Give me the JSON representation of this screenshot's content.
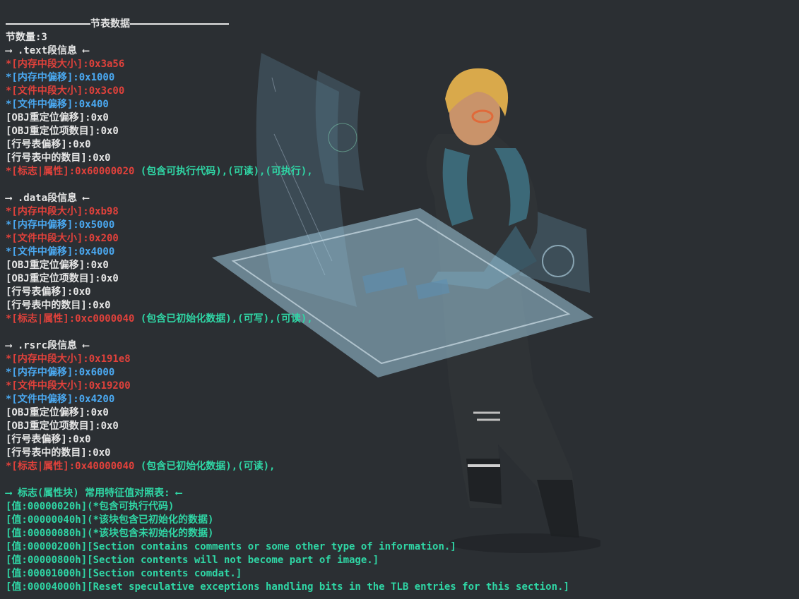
{
  "colors": {
    "background": "#2b2f33",
    "text_default": "#e6e6e6",
    "text_size_field": "#e0413b",
    "text_offset_field": "#4aa8f0",
    "text_flag_desc": "#2fd6a5"
  },
  "header": {
    "title": "节表数据",
    "count": "节数量:3"
  },
  "sections": [
    {
      "heading": "⟶ .text段信息 ⟵",
      "mem_size": "*[内存中段大小]:0x3a56",
      "mem_offset": "*[内存中偏移]:0x1000",
      "file_size": "*[文件中段大小]:0x3c00",
      "file_offset": "*[文件中偏移]:0x400",
      "obj_reloc_offset": "[OBJ重定位偏移]:0x0",
      "obj_reloc_count": "[OBJ重定位项数目]:0x0",
      "line_table_offset": "[行号表偏移]:0x0",
      "line_table_count": "[行号表中的数目]:0x0",
      "flags_value": "*[标志|属性]:0x60000020",
      "flags_desc": "(包含可执行代码),(可读),(可执行),"
    },
    {
      "heading": "⟶ .data段信息 ⟵",
      "mem_size": "*[内存中段大小]:0xb98",
      "mem_offset": "*[内存中偏移]:0x5000",
      "file_size": "*[文件中段大小]:0x200",
      "file_offset": "*[文件中偏移]:0x4000",
      "obj_reloc_offset": "[OBJ重定位偏移]:0x0",
      "obj_reloc_count": "[OBJ重定位项数目]:0x0",
      "line_table_offset": "[行号表偏移]:0x0",
      "line_table_count": "[行号表中的数目]:0x0",
      "flags_value": "*[标志|属性]:0xc0000040",
      "flags_desc": "(包含已初始化数据),(可写),(可读),"
    },
    {
      "heading": "⟶ .rsrc段信息 ⟵",
      "mem_size": "*[内存中段大小]:0x191e8",
      "mem_offset": "*[内存中偏移]:0x6000",
      "file_size": "*[文件中段大小]:0x19200",
      "file_offset": "*[文件中偏移]:0x4200",
      "obj_reloc_offset": "[OBJ重定位偏移]:0x0",
      "obj_reloc_count": "[OBJ重定位项数目]:0x0",
      "line_table_offset": "[行号表偏移]:0x0",
      "line_table_count": "[行号表中的数目]:0x0",
      "flags_value": "*[标志|属性]:0x40000040",
      "flags_desc": "(包含已初始化数据),(可读),"
    }
  ],
  "reference": {
    "heading": "⟶ 标志(属性块) 常用特征值对照表: ⟵",
    "rows": [
      "[值:00000020h](*包含可执行代码)",
      "[值:00000040h](*该块包含已初始化的数据)",
      "[值:00000080h](*该块包含未初始化的数据)",
      "[值:00000200h][Section contains comments or some other type of information.]",
      "[值:00000800h][Section contents will not become part of image.]",
      "[值:00001000h][Section contents comdat.]",
      "[值:00004000h][Reset speculative exceptions handling bits in the TLB entries for this section.]"
    ]
  }
}
